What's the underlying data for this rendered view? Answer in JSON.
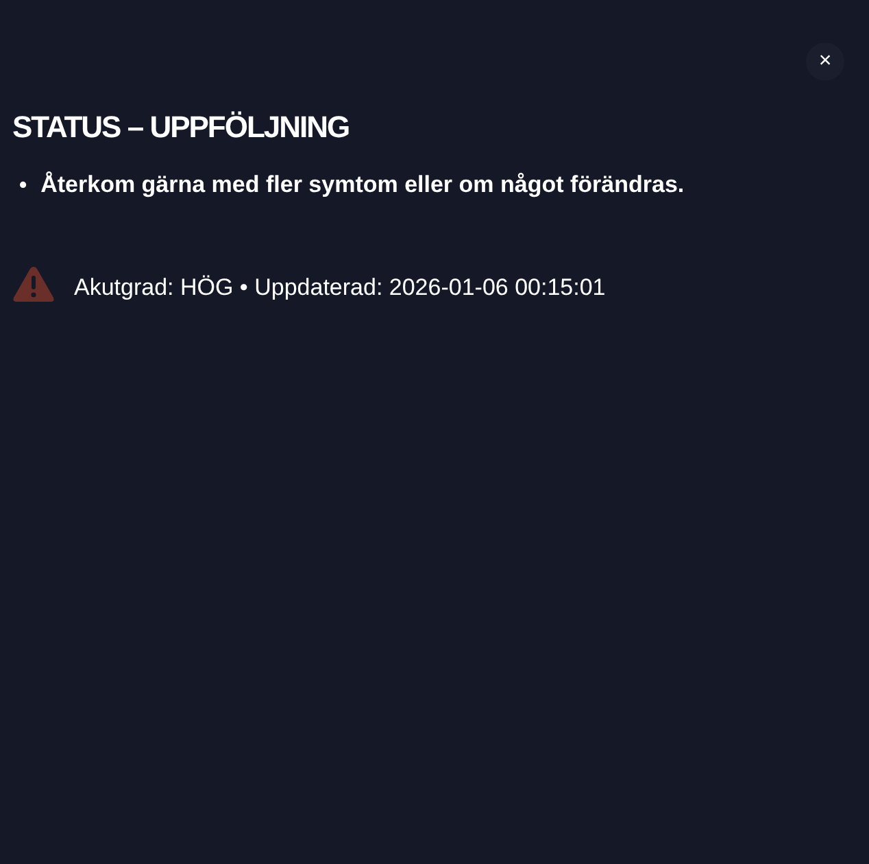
{
  "close_button": "×",
  "title": "STATUS – UPPFÖLJNING",
  "bullets": [
    {
      "marker": "•",
      "text": "Återkom gärna med fler symtom eller om något förändras."
    }
  ],
  "status": {
    "text": "Akutgrad: HÖG • Uppdaterad: 2026-01-06 00:15:01"
  }
}
